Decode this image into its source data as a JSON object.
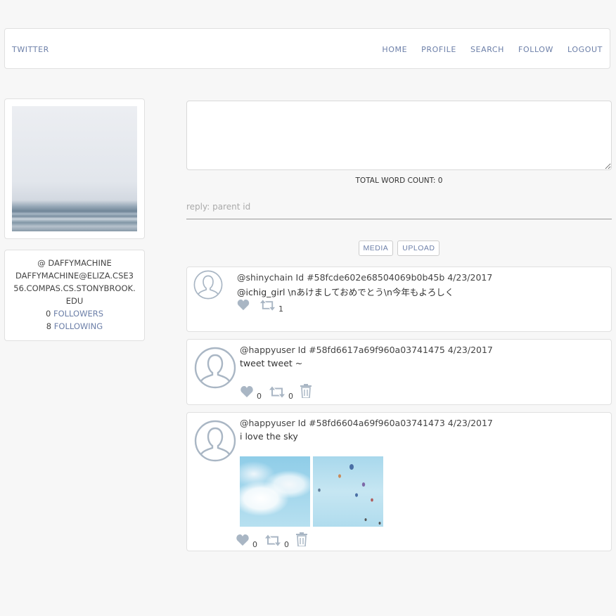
{
  "nav": {
    "brand": "TWITTER",
    "links": [
      "HOME",
      "PROFILE",
      "SEARCH",
      "FOLLOW",
      "LOGOUT"
    ]
  },
  "profile": {
    "handle": "@ DAFFYMACHINE",
    "email": "DAFFYMACHINE@ELIZA.CSE356.COMPAS.CS.STONYBROOK.EDU",
    "followers_count": "0",
    "followers_label": "FOLLOWERS",
    "following_count": "8",
    "following_label": "FOLLOWING"
  },
  "compose": {
    "text": "",
    "word_count_label": "TOTAL WORD COUNT: 0",
    "reply_placeholder": "reply: parent id",
    "media_button": "MEDIA",
    "upload_button": "UPLOAD"
  },
  "tweets": [
    {
      "header": "@shinychain Id #58fcde602e68504069b0b45b 4/23/2017",
      "content": "@ichig_girl \\nあけましておめでとう\\n今年もよろしく",
      "likes": "",
      "retweets": "1",
      "deletable": false
    },
    {
      "header": "@happyuser Id #58fd6617a69f960a03741475 4/23/2017",
      "content": "tweet tweet ~",
      "likes": "0",
      "retweets": "0",
      "deletable": true
    },
    {
      "header": "@happyuser Id #58fd6604a69f960a03741473 4/23/2017",
      "content": "i love the sky",
      "likes": "0",
      "retweets": "0",
      "deletable": true
    }
  ],
  "colors": {
    "accent": "#6c7fa8",
    "icon": "#a9b6c4",
    "background": "#f7f7f7"
  }
}
